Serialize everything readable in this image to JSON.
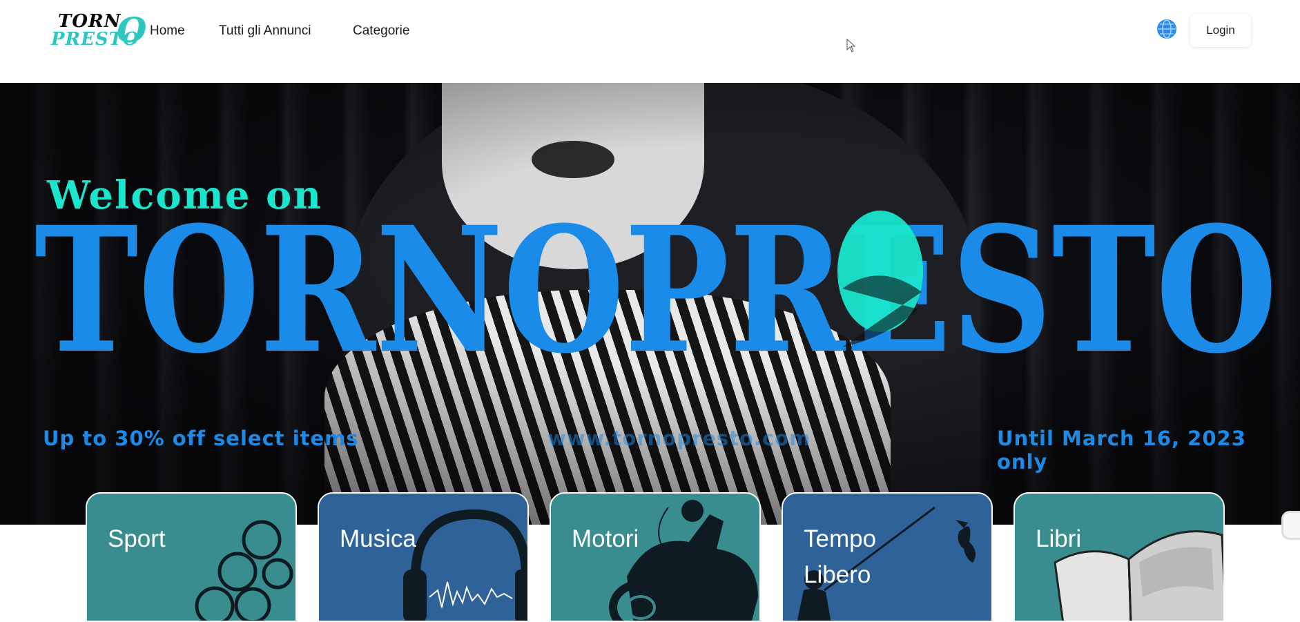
{
  "header": {
    "logo_line1": "TORN",
    "logo_line2": "PRESTO",
    "logo_mark": "O",
    "nav": [
      {
        "label": "Home"
      },
      {
        "label": "Tutti gli Annunci"
      },
      {
        "label": "Categorie"
      }
    ],
    "login_label": "Login",
    "language_icon": "globe-icon"
  },
  "hero": {
    "welcome": "Welcome on",
    "brand": "TORNOPRESTO",
    "promo_left": "Up to 30% off select items",
    "promo_center": "www.tornopresto.com",
    "promo_right": "Until March 16, 2023 only"
  },
  "categories": [
    {
      "label": "Sport",
      "icon": "olympic-rings-icon"
    },
    {
      "label": "Musica",
      "icon": "headphones-icon"
    },
    {
      "label": "Motori",
      "icon": "motorcycle-icon"
    },
    {
      "label": "Tempo Libero",
      "icon": "fishing-icon"
    },
    {
      "label": "Libri",
      "icon": "open-book-icon"
    }
  ],
  "colors": {
    "accent_blue": "#1a8be8",
    "accent_cyan": "#19e6cc",
    "card_teal": "#3a8d8f",
    "card_blue": "#2e6298"
  }
}
